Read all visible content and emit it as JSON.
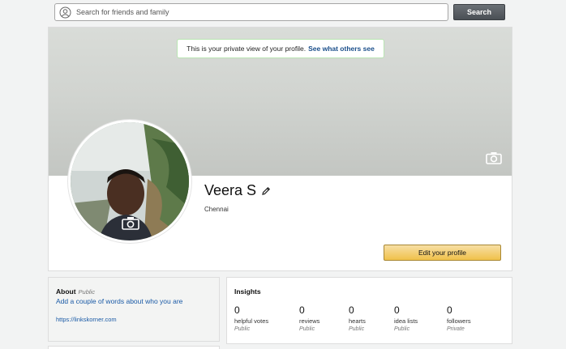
{
  "search": {
    "placeholder": "Search for friends and family",
    "button_label": "Search",
    "icon": "user-circle-icon"
  },
  "cover": {
    "banner_text": "This is your private view of your profile.",
    "banner_link": "See what others see",
    "camera_icon": "camera-icon"
  },
  "profile": {
    "name": "Veera S",
    "location": "Chennai",
    "edit_button": "Edit your profile",
    "edit_icon": "pencil-icon"
  },
  "about": {
    "title": "About",
    "visibility": "Public",
    "prompt": "Add a couple of words about who you are",
    "url": "https://linkskorner.com"
  },
  "insights": {
    "title": "Insights",
    "stats": [
      {
        "value": "0",
        "label": "helpful votes",
        "privacy": "Public"
      },
      {
        "value": "0",
        "label": "reviews",
        "privacy": "Public"
      },
      {
        "value": "0",
        "label": "hearts",
        "privacy": "Public"
      },
      {
        "value": "0",
        "label": "idea lists",
        "privacy": "Public"
      },
      {
        "value": "0",
        "label": "followers",
        "privacy": "Private"
      }
    ]
  },
  "colors": {
    "link": "#1a5aa6",
    "button_primary": "#f0c14b",
    "search_button": "#4a4f55",
    "banner_border": "#b9e5b2"
  }
}
